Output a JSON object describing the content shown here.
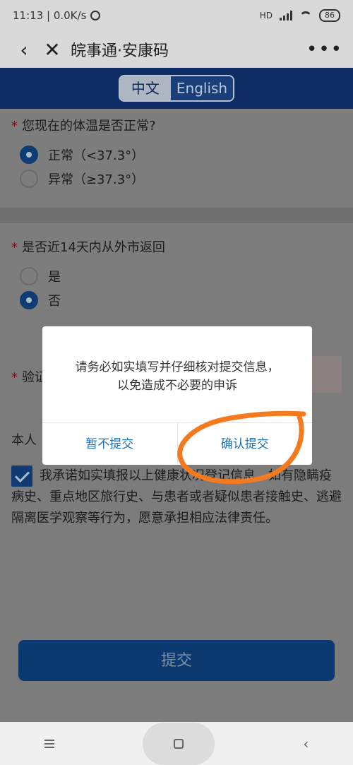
{
  "status_bar": {
    "time_speed": "11:13 | 0.0K/s",
    "network": "HD",
    "battery": "86"
  },
  "title_bar": {
    "title": "皖事通·安康码",
    "more": "•••"
  },
  "language": {
    "chinese": "中文",
    "english": "English"
  },
  "form": {
    "q1": {
      "label": "您现在的体温是否正常?",
      "options": [
        "正常（<37.3°）",
        "异常（≥37.3°）"
      ],
      "selected_index": 0
    },
    "q2": {
      "label": "是否近14天内从外市返回",
      "options": [
        "是",
        "否"
      ],
      "selected_index": 1
    },
    "verify_label": "验证",
    "person_label": "本人",
    "commitment": "我承诺如实填报以上健康状况登记信息，如有隐瞒疫病史、重点地区旅行史、与患者或者疑似患者接触史、逃避隔离医学观察等行为，愿意承担相应法律责任。",
    "commitment_checked": true,
    "submit_label": "提交"
  },
  "dialog": {
    "message_line1": "请务必如实填写并仔细核对提交信息，",
    "message_line2": "以免造成不必要的申诉",
    "cancel_label": "暂不提交",
    "confirm_label": "确认提交"
  },
  "colors": {
    "header_blue": "#0c2c63",
    "accent_blue": "#1e73b4",
    "annotation_orange": "#f47a20"
  }
}
